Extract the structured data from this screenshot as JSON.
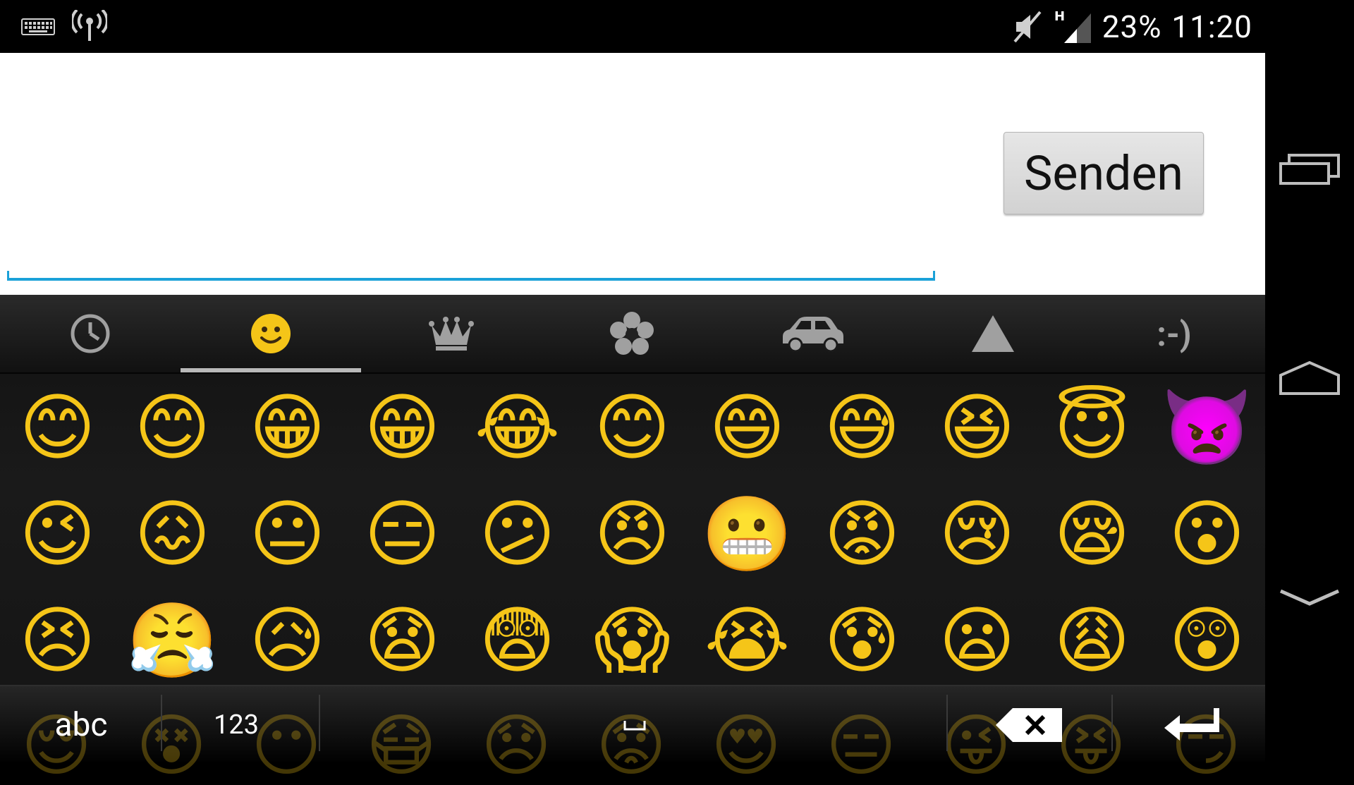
{
  "status_bar": {
    "left_icons": [
      "keyboard-icon",
      "wifi-hotspot-icon"
    ],
    "right_icons": [
      "vibrate-mute-icon",
      "signal-h-icon"
    ],
    "battery": "23%",
    "time": "11:20"
  },
  "app": {
    "input_value": "",
    "send_label": "Senden",
    "colors": {
      "underline": "#1ba1d8"
    }
  },
  "keyboard": {
    "categories": [
      {
        "icon": "recent-clock-icon"
      },
      {
        "icon": "smiley-face-icon",
        "selected": true
      },
      {
        "icon": "crown-icon"
      },
      {
        "icon": "flower-icon"
      },
      {
        "icon": "car-icon"
      },
      {
        "icon": "triangle-symbol-icon"
      },
      {
        "icon": "text-emoticon-icon",
        "label": ":-)"
      }
    ],
    "emoji_rows": [
      [
        "😊",
        "😊",
        "😁",
        "😁",
        "😂",
        "😊",
        "😄",
        "😅",
        "😆",
        "😇",
        "👿"
      ],
      [
        "😉",
        "😖",
        "😐",
        "😑",
        "😕",
        "😠",
        "😬",
        "😡",
        "😢",
        "😪",
        "😮"
      ],
      [
        "😣",
        "😤",
        "😥",
        "😧",
        "😨",
        "😱",
        "😭",
        "😰",
        "😦",
        "😩",
        "😲"
      ]
    ],
    "bottom": {
      "abc_label": "abc",
      "num_label": "123",
      "space_label": "␣",
      "faded_emoji": [
        "😌",
        "😵",
        "😶",
        "😷",
        "😞",
        "😟",
        "😍",
        "😑",
        "😜",
        "😝",
        "😏"
      ]
    }
  },
  "nav": {
    "buttons": [
      "recent-apps-icon",
      "home-icon",
      "back-icon"
    ]
  }
}
